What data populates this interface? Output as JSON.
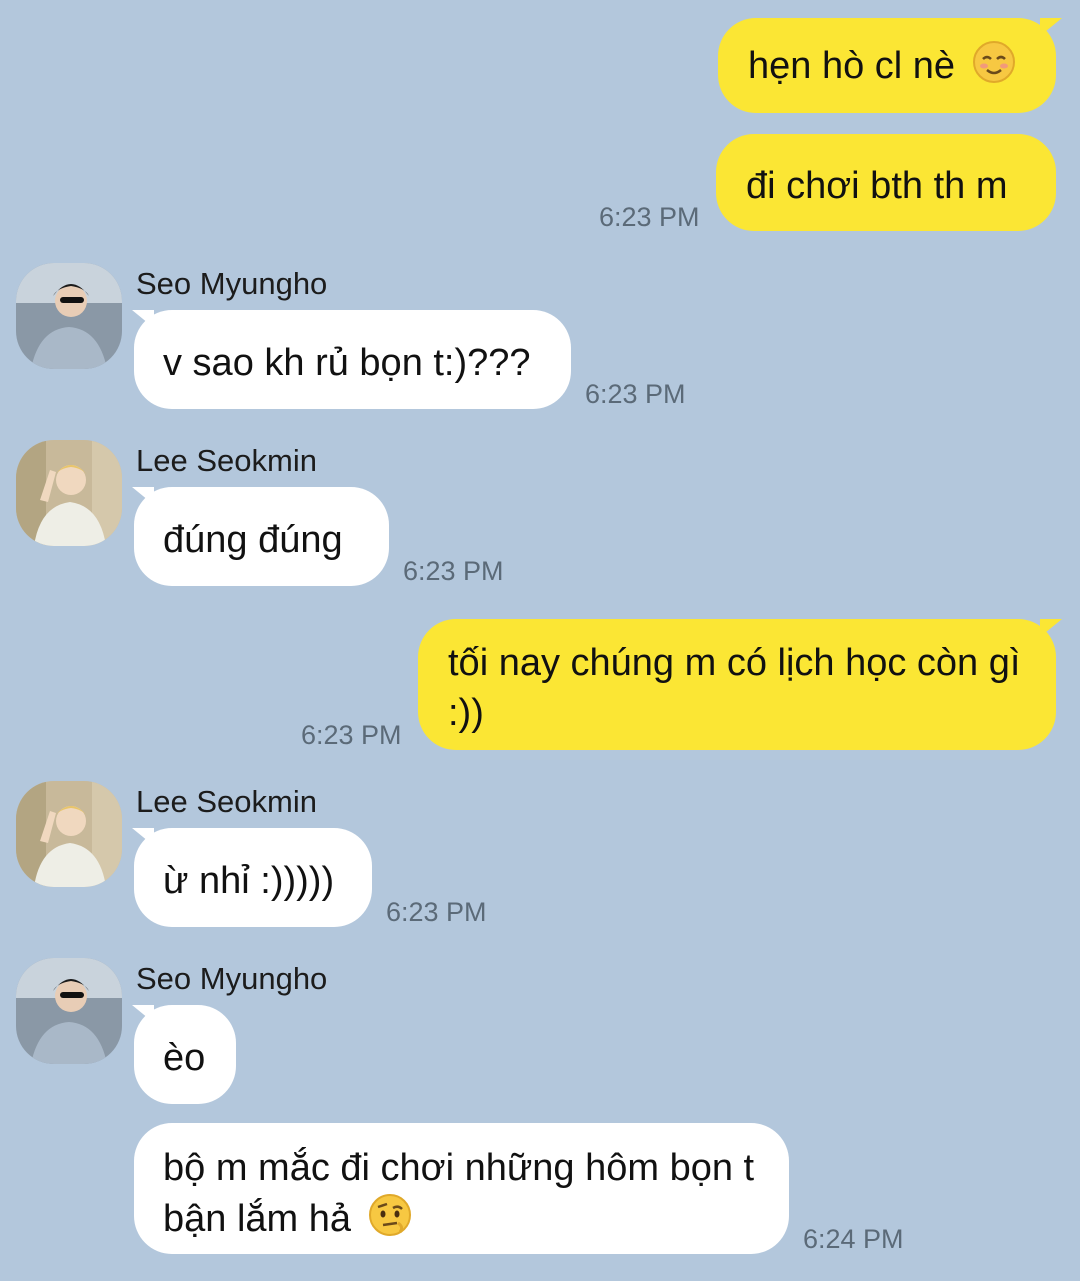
{
  "colors": {
    "background": "#b3c7dc",
    "my_bubble": "#fbe634",
    "other_bubble": "#ffffff",
    "time_text": "#5b6a78"
  },
  "messages": {
    "m1": {
      "text": "hẹn hò cl nè",
      "emoji": "smiling-blush-emoji"
    },
    "m2": {
      "text": "đi chơi bth th m",
      "time": "6:23 PM"
    },
    "m3": {
      "sender": "Seo Myungho",
      "text": "v sao kh rủ bọn t:)???",
      "time": "6:23 PM",
      "avatar": "avatar-seo-myungho"
    },
    "m4": {
      "sender": "Lee Seokmin",
      "text": "đúng đúng",
      "time": "6:23 PM",
      "avatar": "avatar-lee-seokmin"
    },
    "m5": {
      "text": "tối nay chúng m có lịch học còn gì :))",
      "time": "6:23 PM"
    },
    "m6": {
      "sender": "Lee Seokmin",
      "text": "ừ nhỉ :)))))",
      "time": "6:23 PM",
      "avatar": "avatar-lee-seokmin"
    },
    "m7": {
      "sender": "Seo Myungho",
      "text": "èo",
      "avatar": "avatar-seo-myungho"
    },
    "m8": {
      "text": "bộ m mắc đi chơi những hôm bọn t bận lắm hả",
      "emoji": "raised-eyebrow-emoji",
      "time": "6:24 PM"
    }
  }
}
